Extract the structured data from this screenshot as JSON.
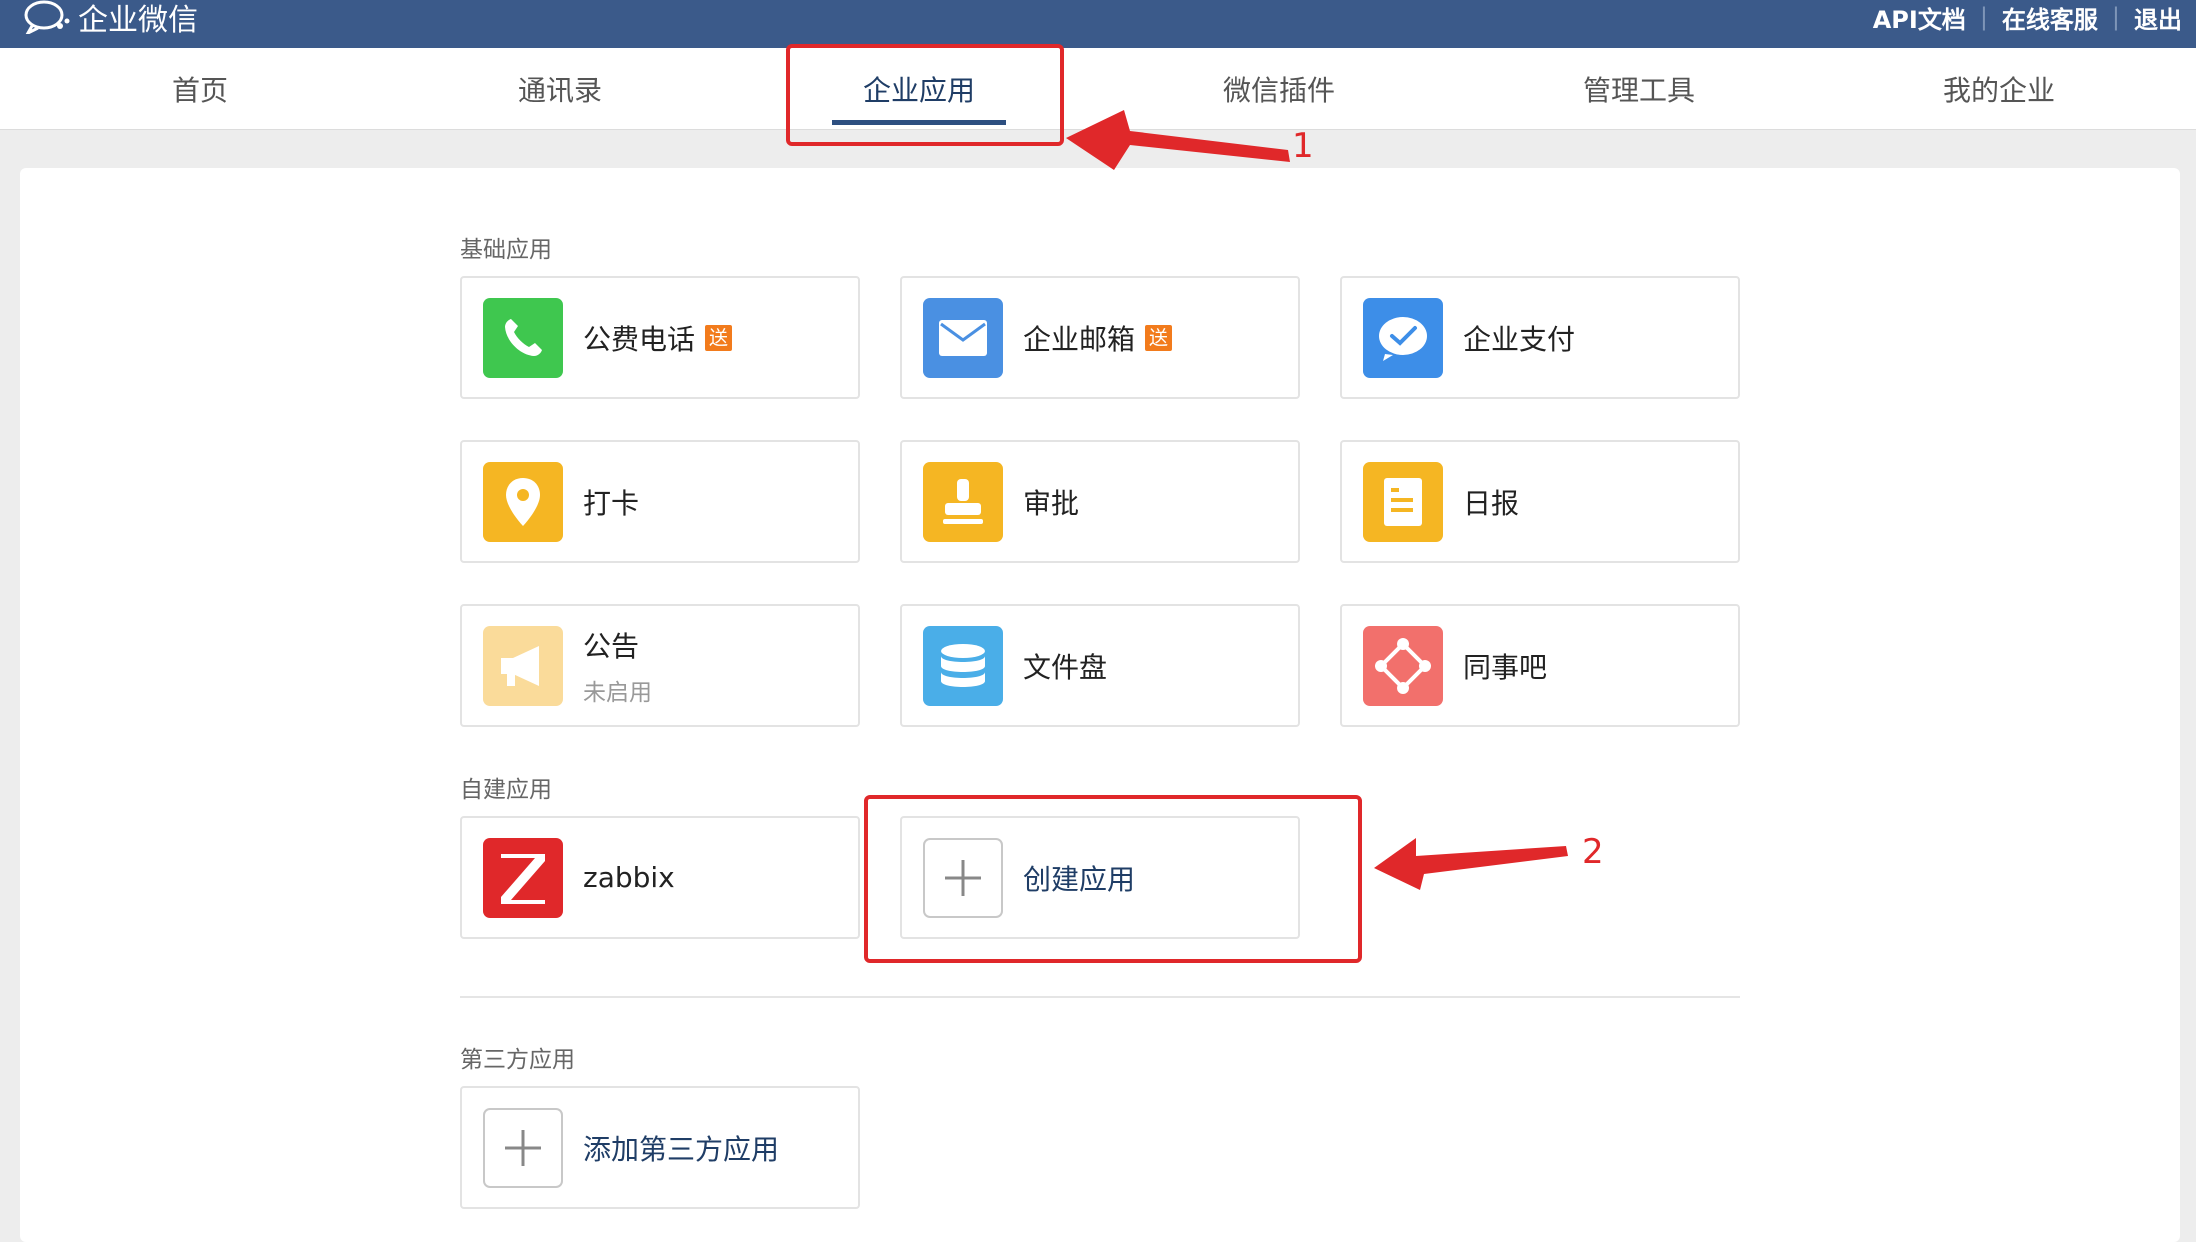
{
  "app": {
    "title": "企业微信"
  },
  "top_links": {
    "api": "API文档",
    "support": "在线客服",
    "logout": "退出",
    "sep": "|"
  },
  "nav": {
    "active_index": 2,
    "tabs": [
      {
        "label": "首页"
      },
      {
        "label": "通讯录"
      },
      {
        "label": "企业应用"
      },
      {
        "label": "微信插件"
      },
      {
        "label": "管理工具"
      },
      {
        "label": "我的企业"
      }
    ]
  },
  "sections": {
    "basic": {
      "title": "基础应用"
    },
    "custom": {
      "title": "自建应用"
    },
    "third_party": {
      "title": "第三方应用"
    }
  },
  "basic_apps": [
    {
      "name": "公费电话",
      "badge": "送",
      "icon": "phone-icon",
      "color": "#3fc74f"
    },
    {
      "name": "企业邮箱",
      "badge": "送",
      "icon": "mail-icon",
      "color": "#4a90e2"
    },
    {
      "name": "企业支付",
      "icon": "pay-icon",
      "color": "#3d8ee8"
    },
    {
      "name": "打卡",
      "icon": "location-pin-icon",
      "color": "#f5b623"
    },
    {
      "name": "审批",
      "icon": "stamp-icon",
      "color": "#f5b623"
    },
    {
      "name": "日报",
      "icon": "report-icon",
      "color": "#f5b623"
    },
    {
      "name": "公告",
      "sub": "未启用",
      "icon": "megaphone-icon",
      "color": "#fadb9a"
    },
    {
      "name": "文件盘",
      "icon": "database-icon",
      "color": "#4aaee8"
    },
    {
      "name": "同事吧",
      "icon": "network-icon",
      "color": "#f2706c"
    }
  ],
  "custom_apps": [
    {
      "name": "zabbix",
      "icon": "zabbix-icon",
      "color": "#e0282a"
    },
    {
      "name": "创建应用",
      "icon": "plus-icon"
    }
  ],
  "third_party_apps": [
    {
      "name": "添加第三方应用",
      "icon": "plus-icon"
    }
  ],
  "annotations": [
    {
      "number": "1"
    },
    {
      "number": "2"
    }
  ],
  "colors": {
    "topbar": "#3b5a8a",
    "annotation": "#e0282a",
    "link": "#1f3d66"
  }
}
